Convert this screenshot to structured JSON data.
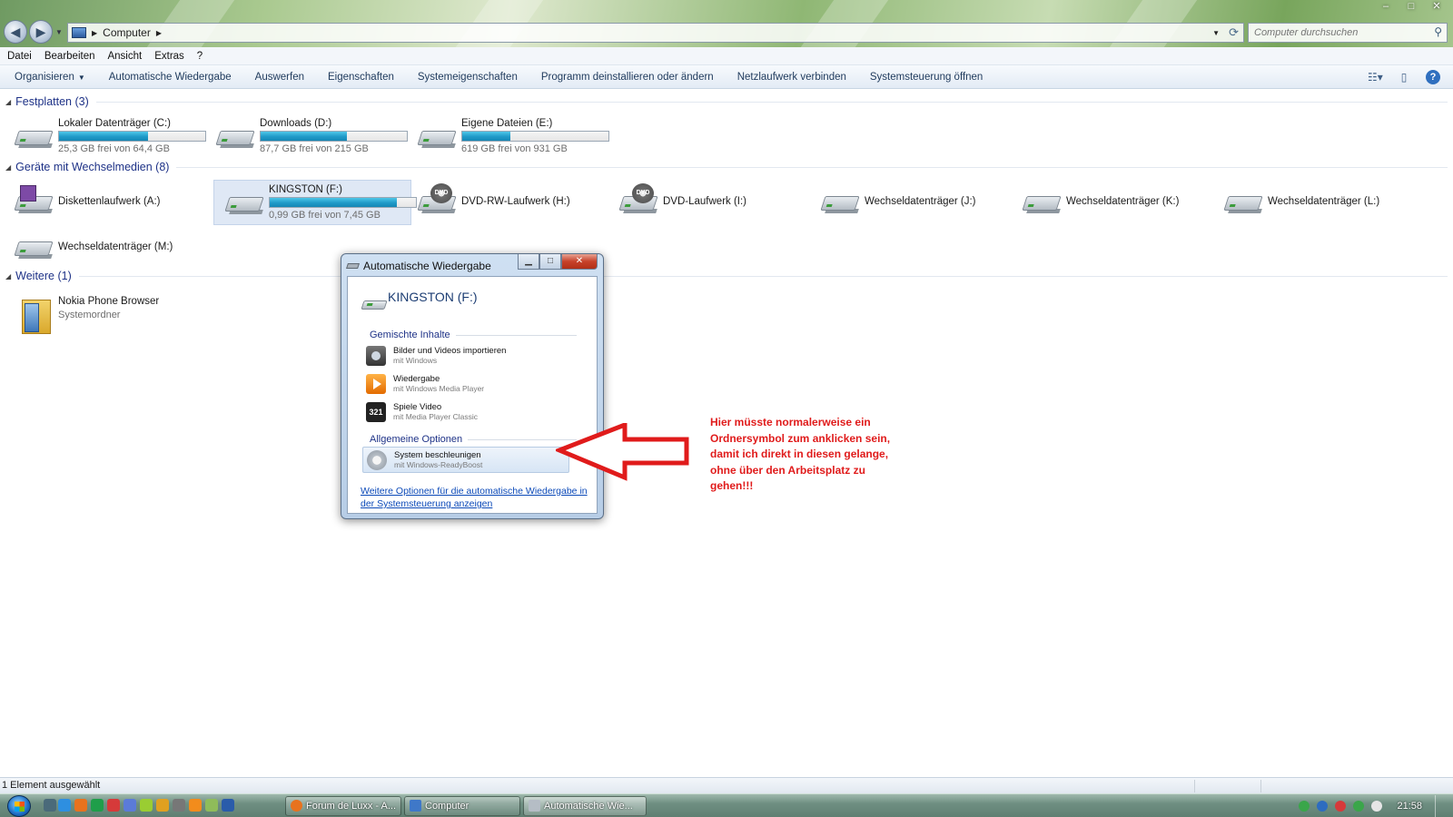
{
  "window": {
    "address_crumb": "Computer",
    "search_placeholder": "Computer durchsuchen",
    "controls": [
      "–",
      "□",
      "✕"
    ]
  },
  "menu": [
    "Datei",
    "Bearbeiten",
    "Ansicht",
    "Extras",
    "?"
  ],
  "commands": [
    "Organisieren",
    "Automatische Wiedergabe",
    "Auswerfen",
    "Eigenschaften",
    "Systemeigenschaften",
    "Programm deinstallieren oder ändern",
    "Netzlaufwerk verbinden",
    "Systemsteuerung öffnen"
  ],
  "groups": {
    "hdd": "Festplatten (3)",
    "removable": "Geräte mit Wechselmedien (8)",
    "other": "Weitere (1)"
  },
  "drives_hdd": [
    {
      "name": "Lokaler Datenträger (C:)",
      "free": "25,3 GB frei von 64,4 GB",
      "used_fraction": 0.61
    },
    {
      "name": "Downloads (D:)",
      "free": "87,7 GB frei von 215 GB",
      "used_fraction": 0.59
    },
    {
      "name": "Eigene Dateien (E:)",
      "free": "619 GB frei von 931 GB",
      "used_fraction": 0.33
    }
  ],
  "drives_removable": [
    {
      "name": "Diskettenlaufwerk (A:)",
      "icon": "floppy-drive-icon"
    },
    {
      "name": "KINGSTON (F:)",
      "free": "0,99 GB frei von 7,45 GB",
      "used_fraction": 0.87,
      "selected": true,
      "icon": "usb-drive-icon"
    },
    {
      "name": "DVD-RW-Laufwerk (H:)",
      "icon": "dvd-drive-icon"
    },
    {
      "name": "DVD-Laufwerk (I:)",
      "icon": "dvd-drive-icon"
    },
    {
      "name": "Wechseldatenträger (J:)",
      "icon": "removable-drive-icon"
    },
    {
      "name": "Wechseldatenträger (K:)",
      "icon": "removable-drive-icon"
    },
    {
      "name": "Wechseldatenträger (L:)",
      "icon": "removable-drive-icon"
    },
    {
      "name": "Wechseldatenträger (M:)",
      "icon": "removable-drive-icon"
    }
  ],
  "other": [
    {
      "name": "Nokia Phone Browser",
      "sub": "Systemordner",
      "icon": "folder-icon"
    }
  ],
  "autoplay": {
    "title": "Automatische Wiedergabe",
    "device": "KINGSTON (F:)",
    "section_mixed": "Gemischte Inhalte",
    "options": [
      {
        "title": "Bilder und Videos importieren",
        "sub": "mit Windows",
        "icon": "camera-icon"
      },
      {
        "title": "Wiedergabe",
        "sub": "mit Windows Media Player",
        "icon": "media-player-icon"
      },
      {
        "title": "Spiele Video",
        "sub": "mit Media Player Classic",
        "icon": "mpc-icon",
        "badge": "321"
      }
    ],
    "section_general": "Allgemeine Optionen",
    "general_option": {
      "title": "System beschleunigen",
      "sub": "mit Windows-ReadyBoost",
      "icon": "readyboost-icon"
    },
    "more_link": "Weitere Optionen für die automatische Wiedergabe in der Systemsteuerung anzeigen"
  },
  "annotation": "Hier müsste normalerweise ein Ordnersymbol zum anklicken sein, damit ich direkt in diesen gelange, ohne über den Arbeitsplatz zu gehen!!!",
  "status": "1 Element ausgewählt",
  "taskbar": {
    "buttons": [
      "Forum de Luxx - A...",
      "Computer",
      "Automatische Wie..."
    ],
    "clock": "21:58"
  },
  "colors": {
    "accent": "#1e3287",
    "annotation": "#e01b1b",
    "progress": "#1f9ac8"
  }
}
